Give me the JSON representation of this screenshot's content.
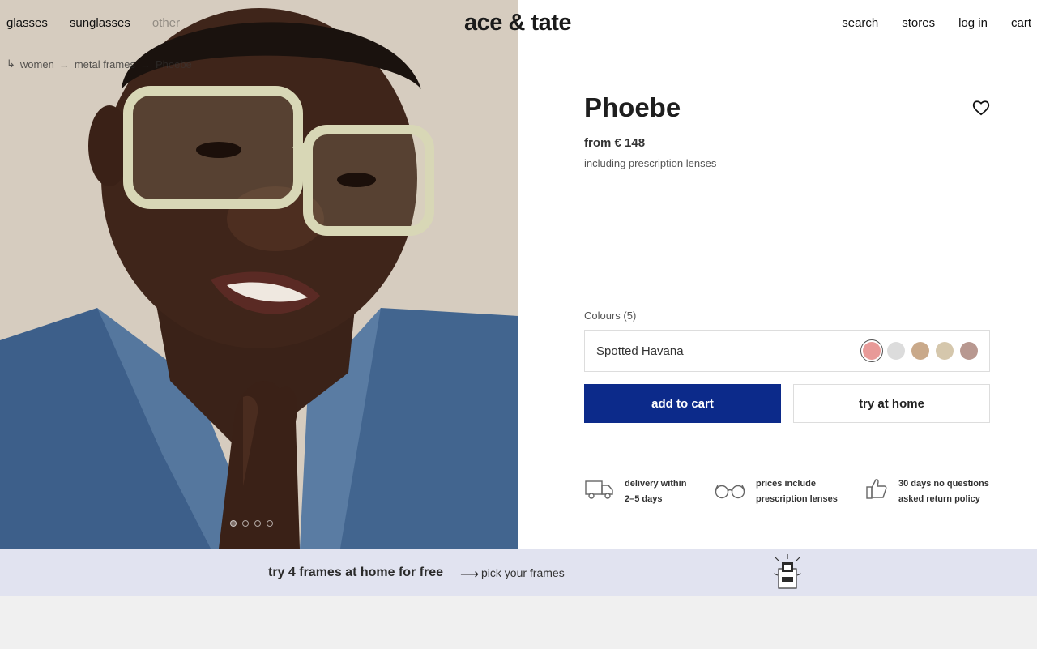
{
  "header": {
    "nav_left": [
      "glasses",
      "sunglasses",
      "other"
    ],
    "logo": "ace & tate",
    "nav_right": [
      "search",
      "stores",
      "log in",
      "cart"
    ]
  },
  "breadcrumb": {
    "prefix": "↳",
    "items": [
      "women",
      "metal frames",
      "Phoebe"
    ],
    "separator": "→"
  },
  "product": {
    "title": "Phoebe",
    "price": "from € 148",
    "price_note": "including prescription lenses",
    "colours_label": "Colours (5)",
    "selected_colour": "Spotted Havana",
    "swatches": [
      "#e89a98",
      "#dcdcdc",
      "#c9a98a",
      "#d5c7ac",
      "#b89890"
    ]
  },
  "actions": {
    "add_to_cart": "add to cart",
    "try_at_home": "try at home"
  },
  "usps": [
    {
      "icon": "truck-icon",
      "line1": "delivery within",
      "line2": "2–5 days"
    },
    {
      "icon": "glasses-icon",
      "line1": "prices include",
      "line2": "prescription lenses"
    },
    {
      "icon": "thumbs-up-icon",
      "line1": "30 days no questions",
      "line2": "asked return policy"
    }
  ],
  "carousel": {
    "count": 4,
    "active": 1
  },
  "banner": {
    "text": "try 4 frames at home for free",
    "arrow": "⟶",
    "link": "pick your frames"
  },
  "colors": {
    "accent": "#0c2a8a",
    "banner_bg": "#e1e3f0"
  }
}
